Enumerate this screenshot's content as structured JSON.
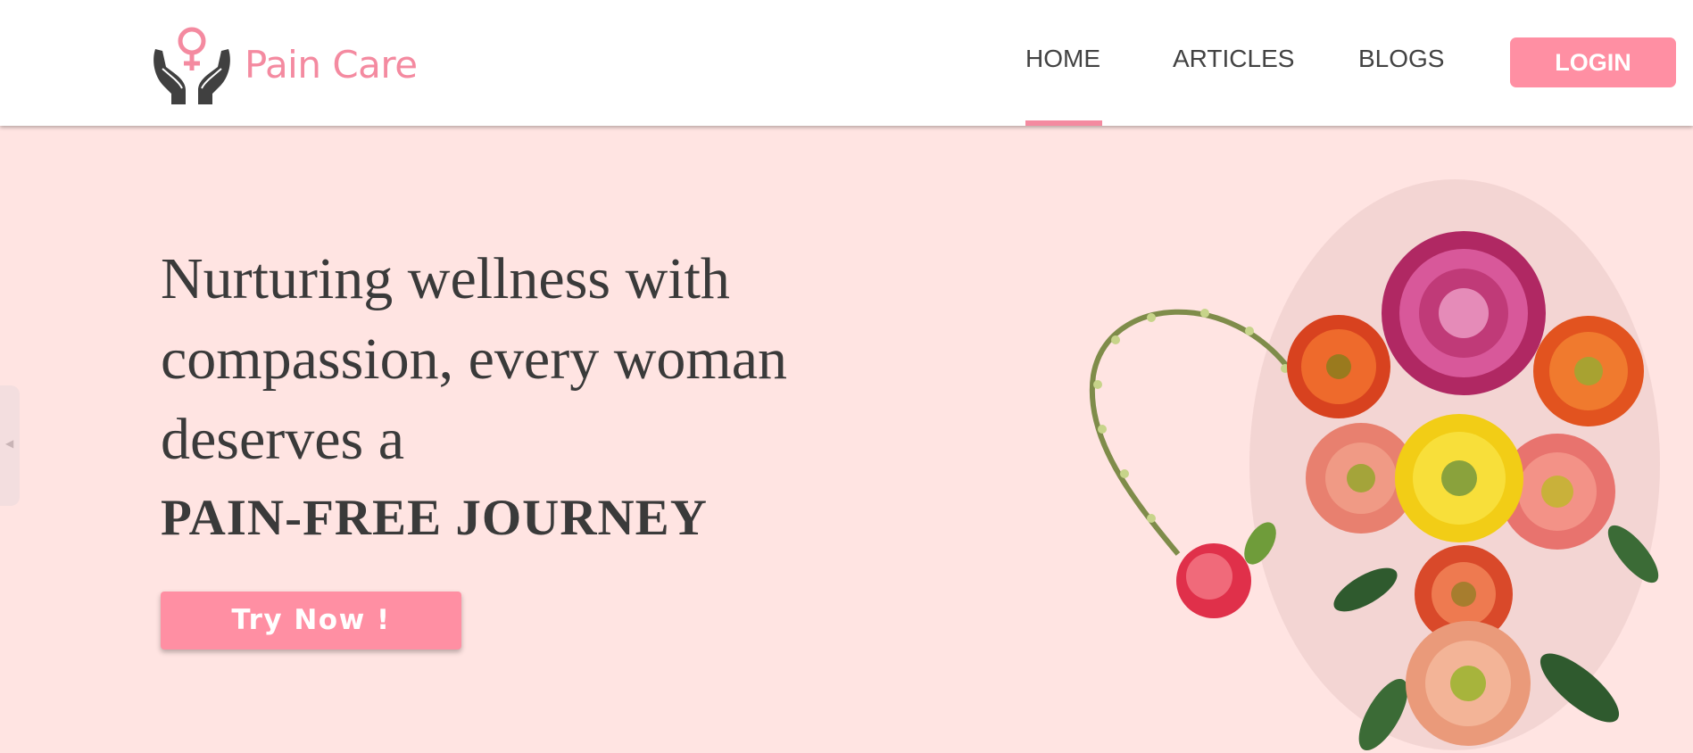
{
  "brand": {
    "name": "Pain Care",
    "icon": "hands-female-symbol-icon"
  },
  "nav": {
    "items": [
      {
        "label": "HOME",
        "active": true
      },
      {
        "label": "ARTICLES",
        "active": false
      },
      {
        "label": "BLOGS",
        "active": false
      }
    ],
    "login_label": "LOGIN"
  },
  "hero": {
    "lines": [
      "Nurturing wellness with",
      "compassion, every woman",
      "deserves a"
    ],
    "highlight": "PAIN-FREE JOURNEY",
    "cta_label": "Try Now !"
  },
  "colors": {
    "accent": "#ff8fa3",
    "brand_text": "#f48aa0",
    "hero_bg": "#ffe4e2",
    "text_dark": "#3a3a3a",
    "nav_text": "#424242"
  }
}
